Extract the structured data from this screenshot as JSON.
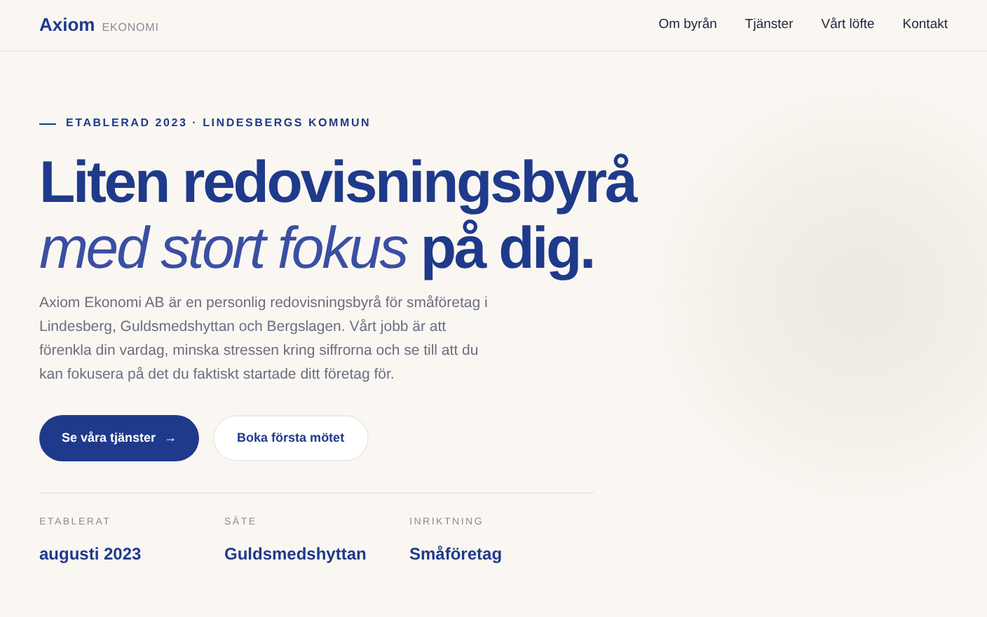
{
  "header": {
    "logo": "Axiom",
    "logo_sub": "EKONOMI",
    "nav": [
      "Om byrån",
      "Tjänster",
      "Vårt löfte",
      "Kontakt"
    ]
  },
  "hero": {
    "eyebrow": "ETABLERAD 2023 · LINDESBERGS KOMMUN",
    "title_line1": "Liten redovisningsbyrå",
    "title_italic": "med stort fokus",
    "title_end": "på dig.",
    "intro": "Axiom Ekonomi AB är en personlig redovisningsbyrå för småföretag i Lindesberg, Guldsmedshyttan och Bergslagen. Vårt jobb är att förenkla din vardag, minska stressen kring siffrorna och se till att du kan fokusera på det du faktiskt startade ditt företag för.",
    "buttons": [
      {
        "kind": "primary",
        "label": "Se våra tjänster",
        "arrow": "→"
      },
      {
        "kind": "secondary",
        "label": "Boka första mötet"
      }
    ]
  },
  "facts": [
    {
      "label": "ETABLERAT",
      "value": "augusti 2023"
    },
    {
      "label": "SÄTE",
      "value": "Guldsmedshyttan"
    },
    {
      "label": "INRIKTNING",
      "value": "Småföretag"
    }
  ]
}
